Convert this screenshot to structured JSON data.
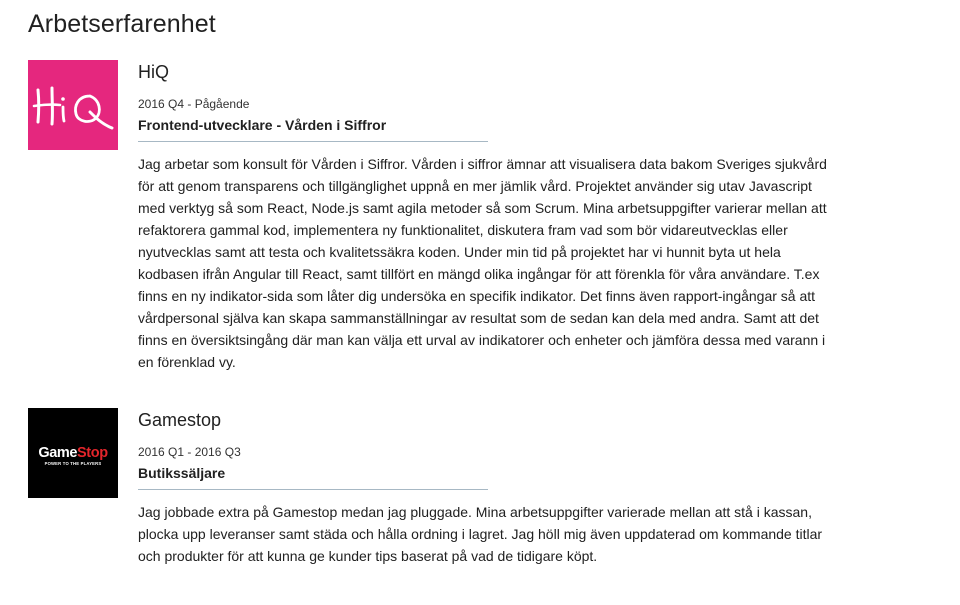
{
  "section": {
    "title": "Arbetserfarenhet"
  },
  "jobs": [
    {
      "company": "HiQ",
      "logo": {
        "text": "HiQ",
        "background": "#e5277e",
        "icon": "hiq-logo-icon"
      },
      "period": "2016 Q4 - Pågående",
      "role": "Frontend-utvecklare - Vården i Siffror",
      "description": "Jag arbetar som konsult för Vården i Siffror. Vården i siffror ämnar att visualisera data bakom Sveriges sjukvård för att genom transparens och tillgänglighet uppnå en mer jämlik vård. Projektet använder sig utav Javascript med verktyg så som React, Node.js samt agila metoder så som Scrum. Mina arbetsuppgifter varierar mellan att refaktorera gammal kod, implementera ny funktionalitet, diskutera fram vad som bör vidareutvecklas eller nyutvecklas samt att testa och kvalitetssäkra koden. Under min tid på projektet har vi hunnit byta ut hela kodbasen ifrån Angular till React, samt tillfört en mängd olika ingångar för att förenkla för våra användare. T.ex finns en ny indikator-sida som låter dig undersöka en specifik indikator. Det finns även rapport-ingångar så att vårdpersonal själva kan skapa sammanställningar av resultat som de sedan kan dela med andra. Samt att det finns en översiktsingång där man kan välja ett urval av indikatorer och enheter och jämföra dessa med varann i en förenklad vy."
    },
    {
      "company": "Gamestop",
      "logo": {
        "text_game": "Game",
        "text_stop": "Stop",
        "tagline": "POWER TO THE PLAYERS",
        "background": "#000000",
        "icon": "gamestop-logo-icon"
      },
      "period": "2016 Q1 - 2016 Q3",
      "role": "Butikssäljare",
      "description": "Jag jobbade extra på Gamestop medan jag pluggade. Mina arbetsuppgifter varierade mellan att stå i kassan, plocka upp leveranser samt städa och hålla ordning i lagret. Jag höll mig även uppdaterad om kommande titlar och produkter för att kunna ge kunder tips baserat på vad de tidigare köpt."
    }
  ]
}
